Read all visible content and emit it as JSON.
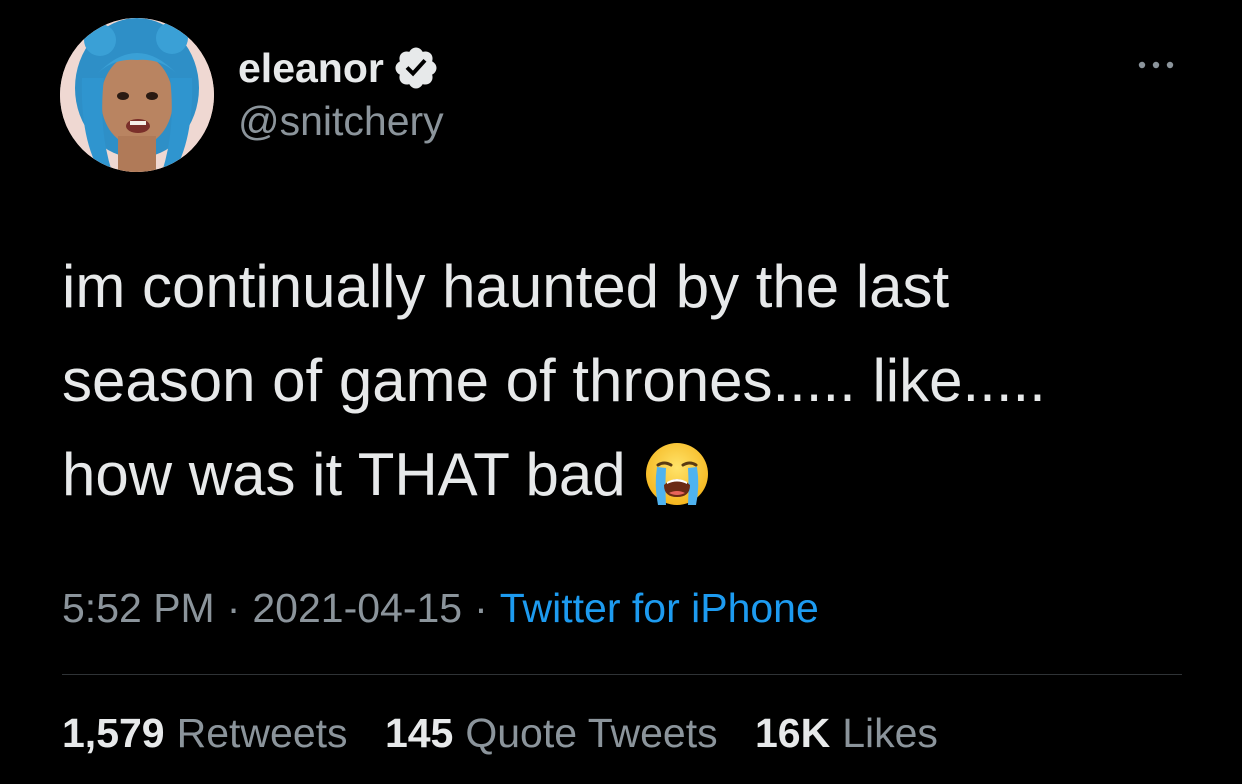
{
  "author": {
    "display_name": "eleanor",
    "handle": "@snitchery",
    "verified": true,
    "avatar_icon": "profile-photo"
  },
  "tweet": {
    "lines": [
      "im continually haunted by the last",
      "season of game of thrones..... like.....",
      "how was it THAT bad"
    ],
    "emoji": "loudly-crying-face"
  },
  "meta": {
    "time": "5:52 PM",
    "separator": "·",
    "date": "2021-04-15",
    "source": "Twitter for iPhone"
  },
  "stats": {
    "retweets_count": "1,579",
    "retweets_label": "Retweets",
    "quotes_count": "145",
    "quotes_label": "Quote Tweets",
    "likes_count": "16K",
    "likes_label": "Likes"
  },
  "colors": {
    "background": "#000000",
    "text": "#e7e9ea",
    "secondary": "#8b949b",
    "link": "#1d9bf0",
    "divider": "#2f3336",
    "verified": "#e7e9ea"
  }
}
